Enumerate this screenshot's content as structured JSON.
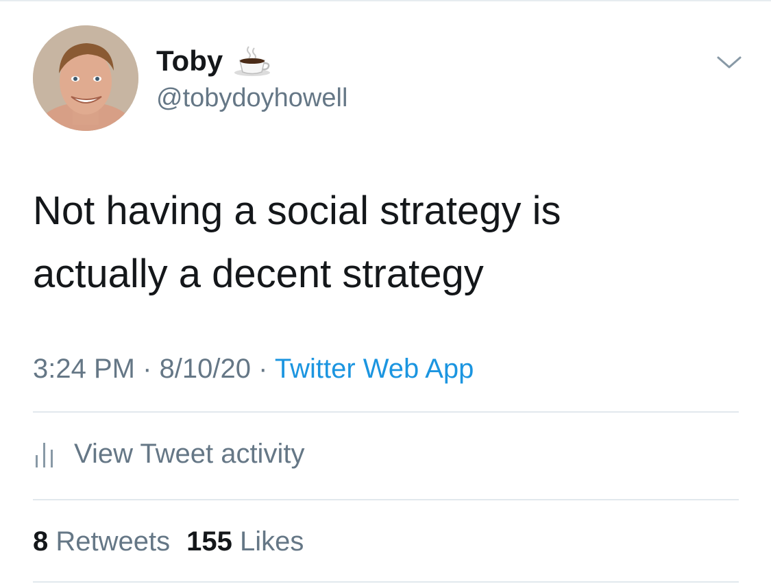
{
  "tweet": {
    "author": {
      "display_name": "Toby",
      "name_emoji": "coffee-icon",
      "handle": "@tobydoyhowell",
      "avatar": "profile-photo"
    },
    "text_line_1": "Not having a social strategy is",
    "text_line_2": "actually a decent strategy",
    "time": "3:24 PM",
    "date": "8/10/20",
    "separator": "·",
    "source": "Twitter Web App",
    "activity_label": "View Tweet activity",
    "retweets_count": "8",
    "retweets_label": "Retweets",
    "likes_count": "155",
    "likes_label": "Likes"
  },
  "colors": {
    "text_primary": "#14171a",
    "text_secondary": "#657786",
    "link": "#1b95e0",
    "divider": "#e1e8ed"
  },
  "icons": {
    "menu": "chevron-down-icon",
    "activity": "bar-chart-icon"
  }
}
